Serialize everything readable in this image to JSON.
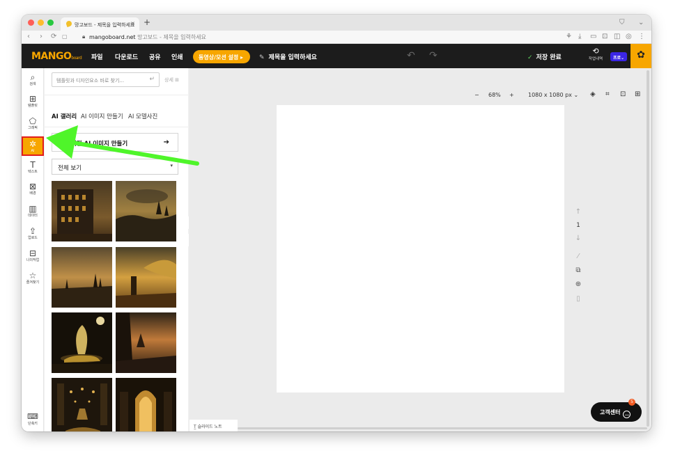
{
  "browser": {
    "tab_title": "망고보드 - 제목을 입력하세요",
    "tab_close": "×",
    "new_tab": "+",
    "url_domain": "mangoboard.net",
    "url_title": "망고보드 - 제목을 입력하세요"
  },
  "toolbar": {
    "logo": "MANGO",
    "logo_sub": "board",
    "menu": [
      "파일",
      "다운로드",
      "공유",
      "인쇄"
    ],
    "motion_button": "동영상/모션 설정 ▸",
    "title_placeholder": "제목을 입력하세요",
    "save_status": "저장 완료",
    "history_label": "작업내역",
    "pro_badge": "프로⌄"
  },
  "sidebar": {
    "items": [
      {
        "icon": "⌕",
        "label": "검색"
      },
      {
        "icon": "⊞",
        "label": "템플릿"
      },
      {
        "icon": "⬠",
        "label": "그래픽"
      },
      {
        "icon": "✲",
        "label": "AI"
      },
      {
        "icon": "T",
        "label": "텍스트"
      },
      {
        "icon": "⊠",
        "label": "배경"
      },
      {
        "icon": "▥",
        "label": "데이터"
      },
      {
        "icon": "⇪",
        "label": "업로드"
      },
      {
        "icon": "⊟",
        "label": "나의작업"
      },
      {
        "icon": "☆",
        "label": "즐겨찾기"
      }
    ],
    "shortcut": {
      "icon": "⌨",
      "label": "단축키"
    }
  },
  "panel": {
    "search_placeholder": "템플릿과 디자인요소 바로 찾기...",
    "search_enter": "↵",
    "detail": "상세",
    "tabs": [
      "AI 갤러리",
      "AI 이미지 만들기",
      "AI 모델사진"
    ],
    "make_button": "직접 AI 이미지 만들기",
    "make_arrow": "➔",
    "dropdown": "전체 보기",
    "caret": "▾"
  },
  "canvas": {
    "zoom_minus": "−",
    "zoom_value": "68%",
    "zoom_plus": "+",
    "size": "1080 x 1080 px",
    "size_caret": "⌄",
    "page_number": "1",
    "notes_tab": "슬라이드 노트",
    "support": "고객센터",
    "support_badge": "5"
  },
  "colors": {
    "accent": "#f7a600",
    "toolbar_bg": "#1c1c1c",
    "highlight_border": "#e21c1c",
    "annotation_arrow": "#4ff52a",
    "pro": "#3b26e6"
  },
  "gallery_icons": [
    "ruined-building",
    "dark-spires",
    "castle-ruins",
    "tower-field",
    "glowing-portal-car",
    "forest-sunset",
    "vehicle-hall",
    "cathedral-arch"
  ]
}
